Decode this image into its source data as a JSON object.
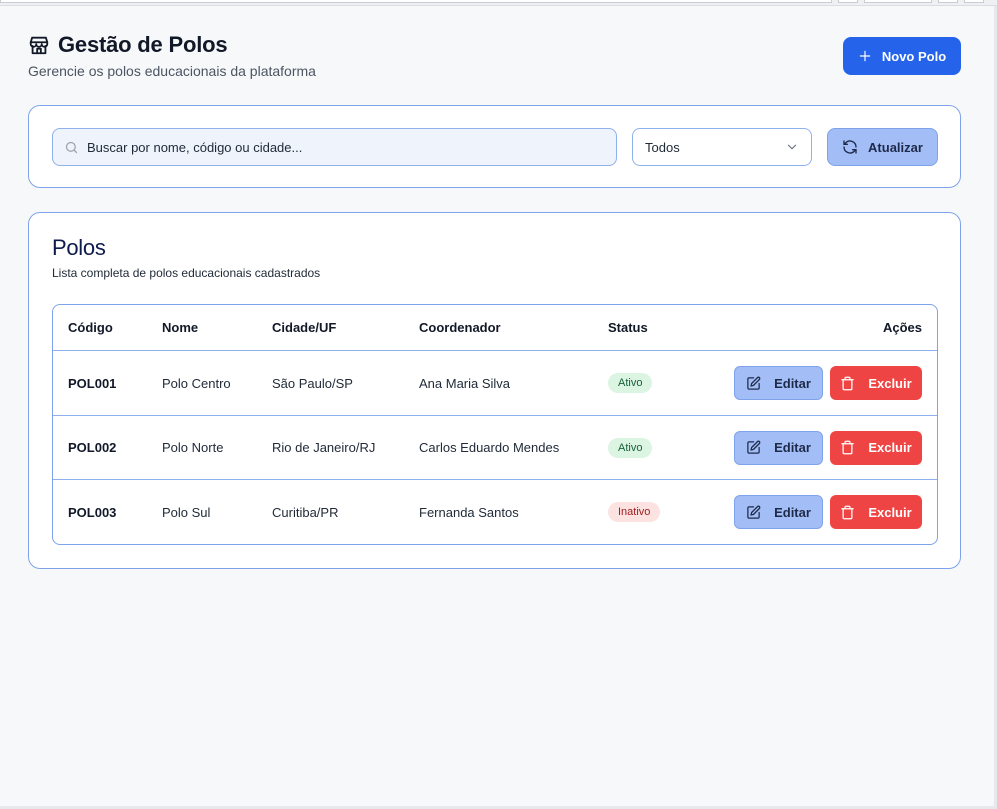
{
  "header": {
    "title": "Gestão de Polos",
    "subtitle": "Gerencie os polos educacionais da plataforma",
    "new_button": "Novo Polo"
  },
  "filters": {
    "search_placeholder": "Buscar por nome, código ou cidade...",
    "status_selected": "Todos",
    "refresh_button": "Atualizar"
  },
  "list": {
    "title": "Polos",
    "subtitle": "Lista completa de polos educacionais cadastrados",
    "columns": [
      "Código",
      "Nome",
      "Cidade/UF",
      "Coordenador",
      "Status",
      "Ações"
    ],
    "rows": [
      {
        "code": "POL001",
        "name": "Polo Centro",
        "city": "São Paulo/SP",
        "coordinator": "Ana Maria Silva",
        "status": "Ativo",
        "edit": "Editar",
        "delete": "Excluir"
      },
      {
        "code": "POL002",
        "name": "Polo Norte",
        "city": "Rio de Janeiro/RJ",
        "coordinator": "Carlos Eduardo Mendes",
        "status": "Ativo",
        "edit": "Editar",
        "delete": "Excluir"
      },
      {
        "code": "POL003",
        "name": "Polo Sul",
        "city": "Curitiba/PR",
        "coordinator": "Fernanda Santos",
        "status": "Inativo",
        "edit": "Editar",
        "delete": "Excluir"
      }
    ]
  },
  "colors": {
    "primary": "#2563eb",
    "secondary": "#a3bdf6",
    "danger": "#ef4444",
    "border": "#7ea3ea"
  }
}
